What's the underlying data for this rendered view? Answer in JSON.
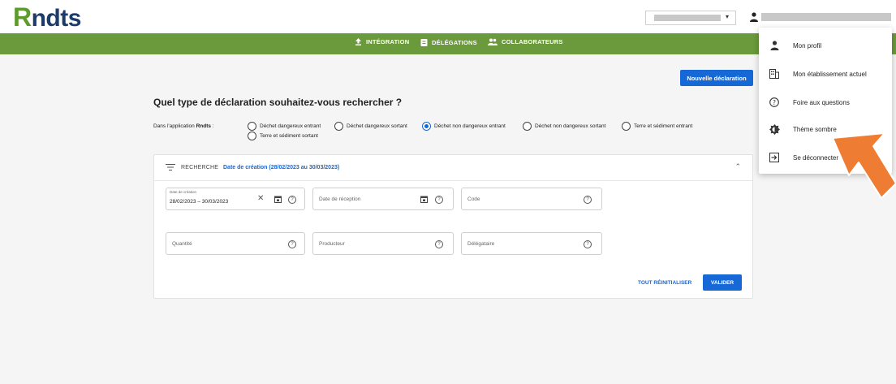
{
  "header": {
    "logo_mark": "R",
    "logo_text": "ndts"
  },
  "nav": {
    "items": [
      {
        "label": "INTÉGRATION",
        "icon": "upload-icon"
      },
      {
        "label": "DÉLÉGATIONS",
        "icon": "clipboard-icon"
      },
      {
        "label": "COLLABORATEURS",
        "icon": "users-icon"
      }
    ]
  },
  "main": {
    "new_declaration": "Nouvelle déclaration",
    "title": "Quel type de déclaration souhaitez-vous rechercher ?",
    "app_label_prefix": "Dans l'application ",
    "app_label_name": "Rndts",
    "app_label_suffix": " :",
    "radio_options": [
      {
        "label": "Déchet dangereux entrant",
        "checked": false
      },
      {
        "label": "Déchet dangereux sortant",
        "checked": false
      },
      {
        "label": "Déchet non dangereux entrant",
        "checked": true
      },
      {
        "label": "Déchet non dangereux sortant",
        "checked": false
      },
      {
        "label": "Terre et sédiment entrant",
        "checked": false
      },
      {
        "label": "Terre et sédiment sortant",
        "checked": false
      }
    ]
  },
  "search": {
    "title": "RECHERCHE",
    "summary": "Date de création (28/02/2023 au 30/03/2023)",
    "fields": {
      "creation_date_label": "Date de création",
      "creation_date_value": "28/02/2023 – 30/03/2023",
      "reception_date": "Date de réception",
      "code": "Code",
      "quantity": "Quantité",
      "producer": "Producteur",
      "delegate": "Délégataire"
    },
    "reset": "TOUT RÉINITIALISER",
    "validate": "VALIDER"
  },
  "user_menu": {
    "items": [
      {
        "label": "Mon profil",
        "icon": "person-icon"
      },
      {
        "label": "Mon établissement actuel",
        "icon": "building-icon"
      },
      {
        "label": "Foire aux questions",
        "icon": "help-circle-icon"
      },
      {
        "label": "Thème sombre",
        "icon": "theme-icon"
      },
      {
        "label": "Se déconnecter",
        "icon": "logout-icon"
      }
    ]
  },
  "colors": {
    "brand_green": "#6a9a3b",
    "primary_blue": "#1668d6",
    "logo_navy": "#1d3b6a",
    "pointer_orange": "#ee7d33"
  }
}
